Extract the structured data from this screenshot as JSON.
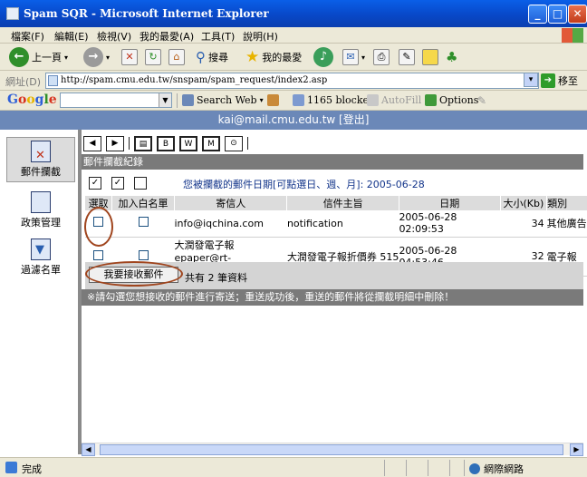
{
  "window": {
    "title": "Spam SQR - Microsoft Internet Explorer"
  },
  "menu": [
    "檔案(F)",
    "編輯(E)",
    "檢視(V)",
    "我的最愛(A)",
    "工具(T)",
    "說明(H)"
  ],
  "toolbar": {
    "back": "上一頁",
    "search": "搜尋",
    "favorites": "我的最愛"
  },
  "address": {
    "label": "網址(D)",
    "url": "http://spam.cmu.edu.tw/snspam/spam_request/index2.asp",
    "go": "移至"
  },
  "googlebar": {
    "logo": "Google",
    "search_web": "Search Web",
    "blocked": "1165 blocked",
    "autofill": "AutoFill",
    "options": "Options"
  },
  "user": {
    "line": "kai@mail.cmu.edu.tw [登出]"
  },
  "sidebar": {
    "items": [
      {
        "label": "郵件攔截"
      },
      {
        "label": "政策管理"
      },
      {
        "label": "過濾名單"
      }
    ]
  },
  "section": {
    "title": "郵件攔截紀錄"
  },
  "date_line": {
    "text": "您被攔截的郵件日期[可點選日、週、月]: ",
    "date": "2005-06-28"
  },
  "table": {
    "headers": [
      "選取",
      "加入白名單",
      "寄信人",
      "信件主旨",
      "日期",
      "大小(Kb)",
      "類別"
    ],
    "rows": [
      {
        "sender_name": "",
        "sender": "info@iqchina.com",
        "subject": "notification",
        "date": "2005-06-28 02:09:53",
        "size": "34",
        "category": "其他廣告"
      },
      {
        "sender_name": "大潤發電子報",
        "sender": "epaper@rt-mart.com.tw",
        "subject": "大潤發電子報折價券 515",
        "date": "2005-06-28 04:53:46",
        "size": "32",
        "category": "電子報"
      }
    ]
  },
  "footer": {
    "receive_button": "我要接收郵件",
    "count": "共有 2 筆資料"
  },
  "note": "※請勾選您想接收的郵件進行寄送；重送成功後，重送的郵件將從攔截明細中刪除！",
  "status": {
    "left": "完成",
    "zone": "網際網路"
  }
}
